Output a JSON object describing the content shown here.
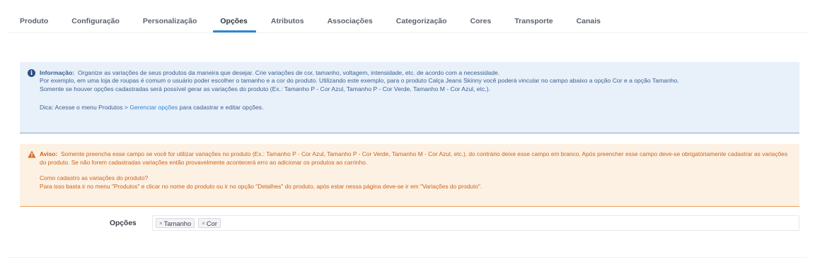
{
  "tabs": [
    "Produto",
    "Configuração",
    "Personalização",
    "Opções",
    "Atributos",
    "Associações",
    "Categorização",
    "Cores",
    "Transporte",
    "Canais"
  ],
  "active_tab": "Opções",
  "info": {
    "icon": "info-icon",
    "title": "Informação:",
    "line1": "Organize as variações de seus produtos da maneira que desejar. Crie variações de cor, tamanho, voltagem, intensidade, etc. de acordo com a necessidade.",
    "line2": "Por exemplo, em uma loja de roupas é comum o usuário poder escolher o tamanho e a cor do produto. Utilizando este exemplo, para o produto Calça Jeans Skinny você poderá vincular no campo abaixo a opção Cor e a opção Tamanho.",
    "line3": "Somente se houver opções cadastradas será possível gerar as variações do produto (Ex.: Tamanho P - Cor Azul, Tamanho P - Cor Verde, Tamanho M - Cor Azul, etc.).",
    "tip_prefix": "Dica: Acesse o menu Produtos > ",
    "tip_link": "Gerenciar opções",
    "tip_suffix": " para cadastrar e editar opções."
  },
  "warning": {
    "icon": "warning-icon",
    "title": "Aviso:",
    "text": "Somente preencha esse campo se você for utilizar variações no produto (Ex.: Tamanho P - Cor Azul, Tamanho P - Cor Verde, Tamanho M - Cor Azul, etc.), do contrário deixe esse campo em branco. Após preencher esse campo deve-se obrigatóriamente cadastrar as variações do produto. Se não forem cadastradas variações então provavelmente acontecerá erro ao adicionar os produtos ao carrinho.",
    "question": "Como cadastro as variações do produto?",
    "answer": "Para isso basta ir no menu \"Produtos\" e clicar no nome do produto ou ir no opção \"Detalhes\" do produto, após estar nessa página deve-se ir em \"Variações do produto\"."
  },
  "options_field": {
    "label": "Opções",
    "chips": [
      {
        "remove": "×",
        "label": "Tamanho"
      },
      {
        "remove": "×",
        "label": "Cor"
      }
    ]
  },
  "colors": {
    "accent": "#2a86d6",
    "info_bg": "#e8f0fa",
    "info_text": "#3d5f8f",
    "warn_bg": "#fdf1e4",
    "warn_text": "#c8641a"
  }
}
